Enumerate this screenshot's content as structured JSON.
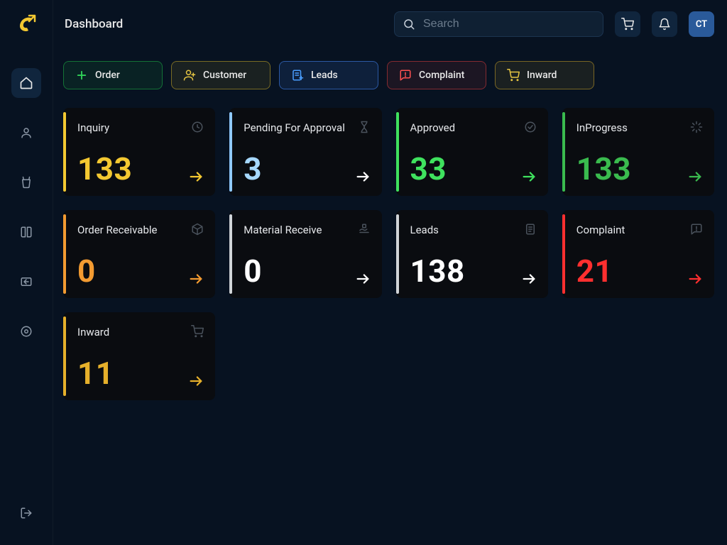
{
  "header": {
    "title": "Dashboard",
    "search_placeholder": "Search",
    "avatar": "CT"
  },
  "actions": {
    "order": "Order",
    "customer": "Customer",
    "leads": "Leads",
    "complaint": "Complaint",
    "inward": "Inward"
  },
  "cards": {
    "inquiry": {
      "label": "Inquiry",
      "value": "133"
    },
    "pending_approval": {
      "label": "Pending For Approval",
      "value": "3"
    },
    "approved": {
      "label": "Approved",
      "value": "33"
    },
    "inprogress": {
      "label": "InProgress",
      "value": "133"
    },
    "order_receivable": {
      "label": "Order Receivable",
      "value": "0"
    },
    "material_receive": {
      "label": "Material Receive",
      "value": "0"
    },
    "leads": {
      "label": "Leads",
      "value": "138"
    },
    "complaint": {
      "label": "Complaint",
      "value": "21"
    },
    "inward": {
      "label": "Inward",
      "value": "11"
    }
  }
}
